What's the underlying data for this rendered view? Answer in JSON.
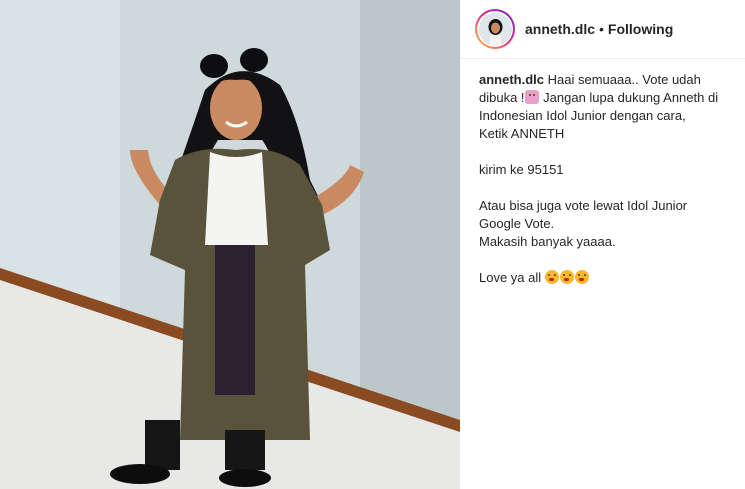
{
  "header": {
    "username": "anneth.dlc",
    "separator": "•",
    "follow_status": "Following"
  },
  "caption": {
    "username": "anneth.dlc",
    "line1_rest": "Haai semuaaa.. Vote udah",
    "line2_before_emoji": "dibuka !",
    "line2_after_emoji": " Jangan lupa dukung Anneth di",
    "line3": "Indonesian Idol Junior dengan cara,",
    "line4": "Ketik ANNETH",
    "line5": "kirim ke 95151",
    "line6": "Atau bisa juga vote lewat Idol Junior",
    "line7": "Google Vote.",
    "line8": "Makasih banyak yaaaa.",
    "line9": "Love ya all"
  },
  "icons": {
    "emoji_hand": "person-raising-hand-emoji",
    "emoji_kiss": "face-blowing-kiss-emoji"
  },
  "colors": {
    "text": "#262626",
    "avatar_ring_start": "#f9ce34",
    "avatar_ring_end": "#6228d7"
  }
}
